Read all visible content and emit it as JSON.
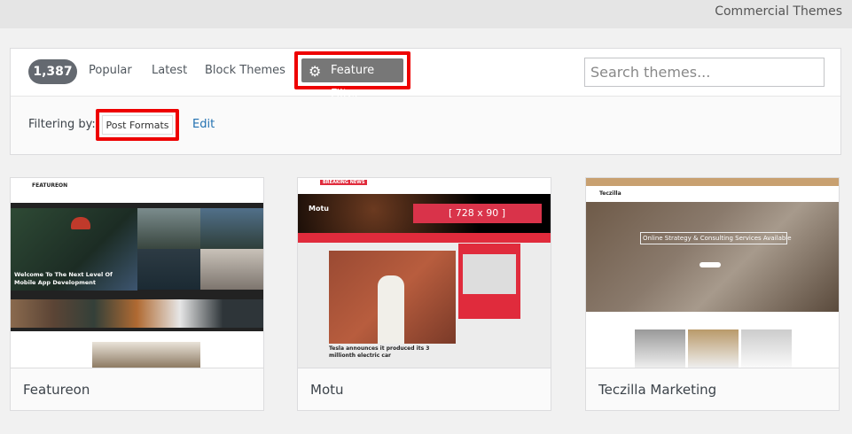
{
  "header": {
    "title": "Commercial Themes"
  },
  "filter_bar": {
    "count": "1,387",
    "tabs": [
      "Popular",
      "Latest",
      "Block Themes"
    ],
    "feature_filter": "Feature Filter",
    "search_placeholder": "Search themes...",
    "filtering_by_label": "Filtering by:",
    "active_filter": "Post Formats",
    "edit_label": "Edit"
  },
  "themes": [
    {
      "name": "Featureon",
      "preview": {
        "logo": "FEATUREON",
        "headline": "Welcome To The Next Level Of Mobile App Development"
      }
    },
    {
      "name": "Motu",
      "preview": {
        "badge": "BREAKING NEWS",
        "logo": "Motu",
        "ad": "[ 728 x 90 ]",
        "headline": "Tesla announces it produced its 3 millionth electric car"
      }
    },
    {
      "name": "Teczilla Marketing",
      "preview": {
        "logo": "Teczilla",
        "headline": "Online Strategy & Consulting Services Available"
      }
    }
  ]
}
